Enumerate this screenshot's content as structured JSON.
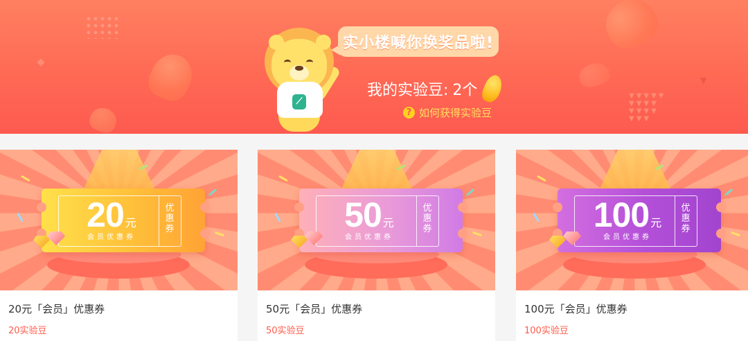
{
  "banner": {
    "speech": "实小楼喊你换奖品啦!",
    "beans_label": "我的实验豆:",
    "beans_count": "2个",
    "help_icon": "question-icon",
    "help_text": "如何获得实验豆",
    "colors": {
      "bg_top": "#ff8061",
      "bg_bottom": "#fd5a4f",
      "help": "#ffe05f"
    }
  },
  "coupons": [
    {
      "amount": "20",
      "unit": "元",
      "subtitle": "会员优惠券",
      "side": "优惠券",
      "title": "20元「会员」优惠券",
      "price": "20实验豆",
      "color": "#ffc03a"
    },
    {
      "amount": "50",
      "unit": "元",
      "subtitle": "会员优惠券",
      "side": "优惠券",
      "title": "50元「会员」优惠券",
      "price": "50实验豆",
      "color": "#e99ad8"
    },
    {
      "amount": "100",
      "unit": "元",
      "subtitle": "会员优惠券",
      "side": "优惠券",
      "title": "100元「会员」优惠券",
      "price": "100实验豆",
      "color": "#b34fd8"
    }
  ],
  "accent_color": "#ff5a4a"
}
